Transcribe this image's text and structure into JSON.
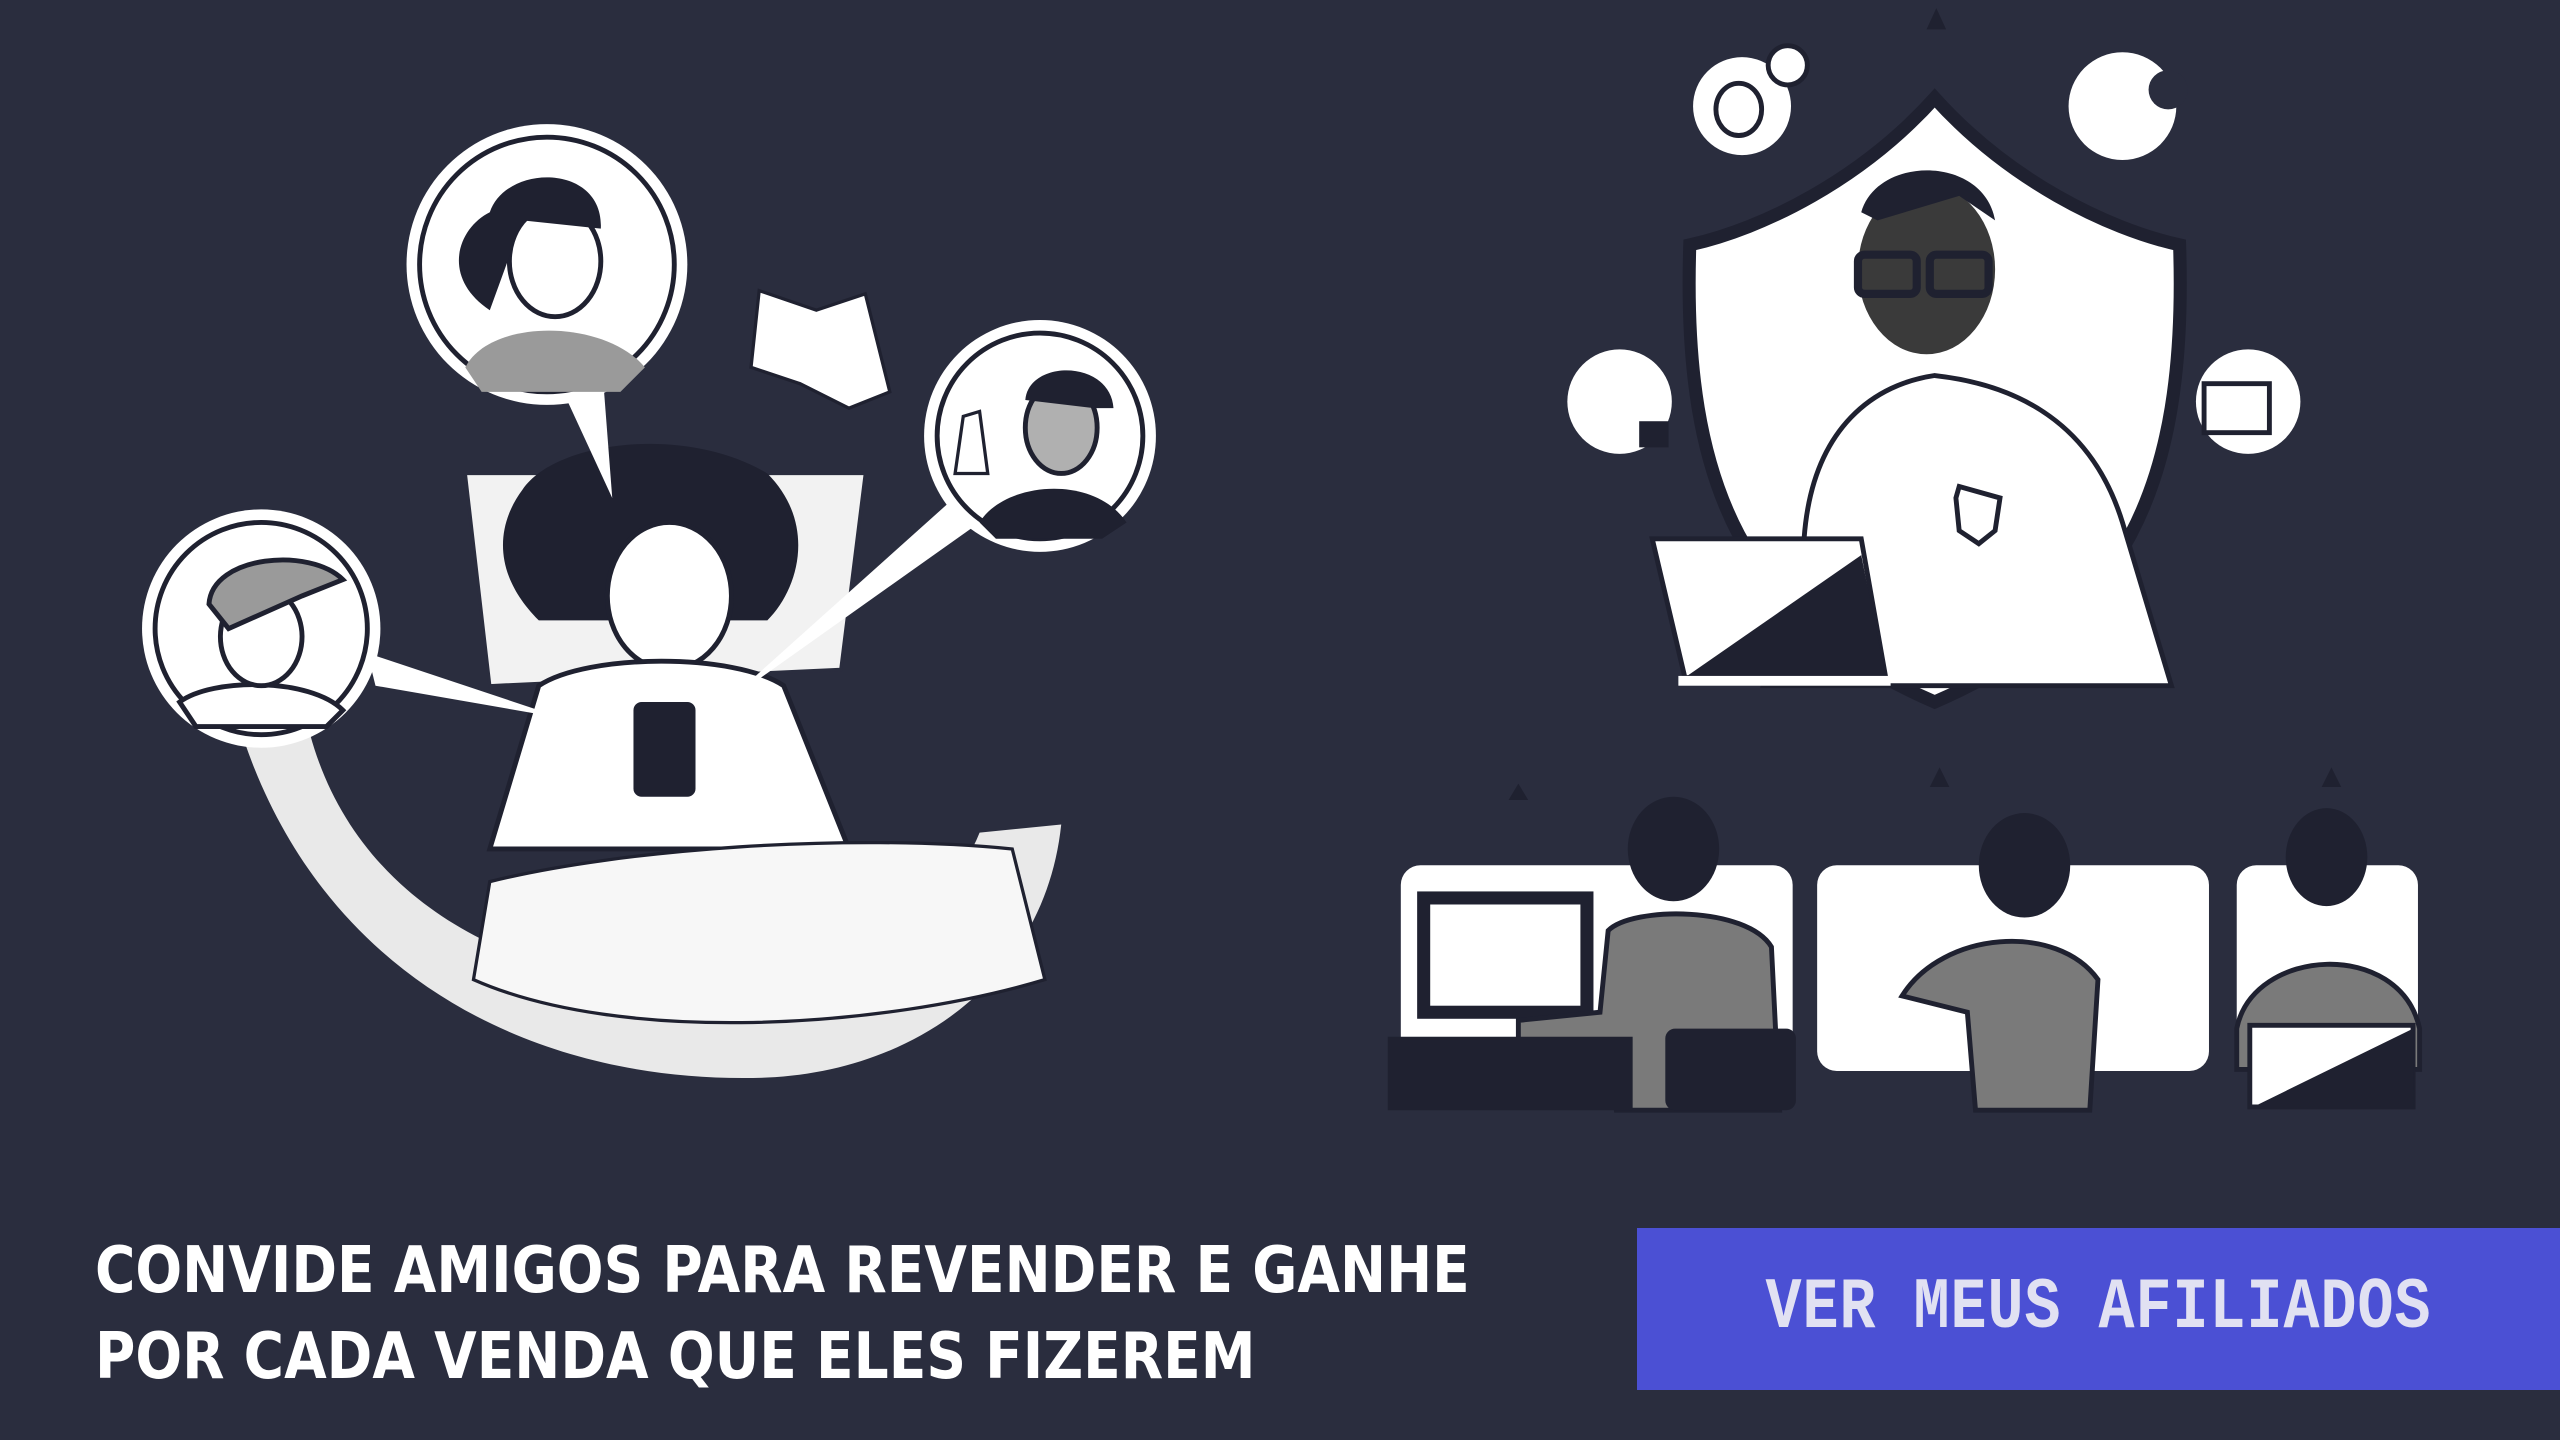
{
  "headline": {
    "line1": "CONVIDE AMIGOS PARA REVENDER E GANHE",
    "line2": "POR CADA VENDA QUE ELES FIZEREM"
  },
  "cta": {
    "label": "VER MEUS AFILIADOS"
  },
  "colors": {
    "background": "#2a2d3e",
    "button": "#4b50d4",
    "button_text": "#e1e1f2",
    "illustration": "#ffffff"
  },
  "illustrations": {
    "left": "woman-in-bed-messaging-friends",
    "right": "security-agent-shield-and-remote-workers"
  }
}
